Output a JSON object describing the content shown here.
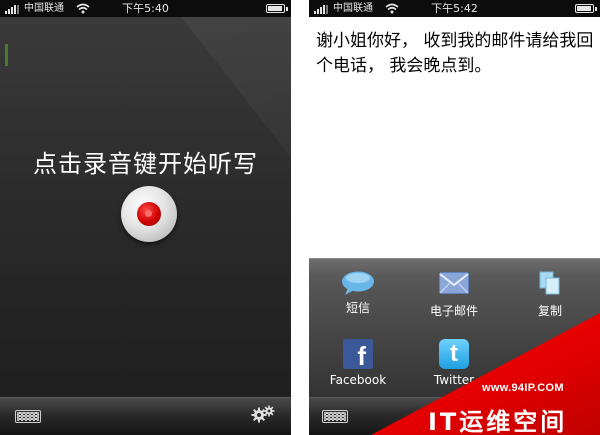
{
  "left_screen": {
    "status": {
      "carrier": "中国联通",
      "time": "下午5:40"
    },
    "prompt": "点击录音键开始听写",
    "bottom": {
      "keyboard_icon": "keyboard-icon",
      "settings_icon": "gears-icon"
    }
  },
  "right_screen": {
    "status": {
      "carrier": "中国联通",
      "time": "下午5:42"
    },
    "message": "谢小姐你好， 收到我的邮件请给我回个电话， 我会晚点到。",
    "share_options": [
      {
        "label": "短信",
        "icon": "sms-bubble-icon"
      },
      {
        "label": "电子邮件",
        "icon": "email-envelope-icon"
      },
      {
        "label": "复制",
        "icon": "copy-icon"
      },
      {
        "label": "Facebook",
        "icon": "facebook-icon"
      },
      {
        "label": "Twitter",
        "icon": "twitter-icon"
      }
    ],
    "bottom": {
      "keyboard_icon": "keyboard-icon"
    }
  },
  "watermark": {
    "url": "www.94IP.COM",
    "text": "IT运维空间"
  },
  "colors": {
    "record_red": "#d00000",
    "panel_gray": "#4a4a4a",
    "watermark_red": "#e10000",
    "facebook_blue": "#3b5998",
    "twitter_blue": "#1fa0e0"
  }
}
